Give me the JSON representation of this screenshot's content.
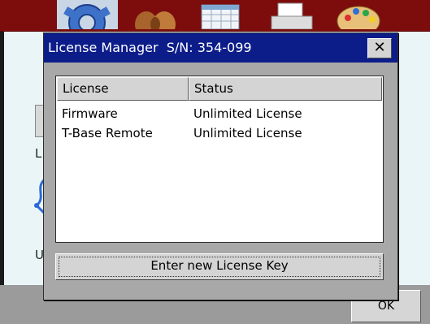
{
  "background": {
    "letters": [
      "L",
      "U"
    ],
    "ok_label": "OK"
  },
  "dialog": {
    "title": "License Manager  S/N: 354-099",
    "close_glyph": "✕",
    "columns": [
      "License",
      "Status"
    ],
    "rows": [
      {
        "license": "Firmware",
        "status": "Unlimited License"
      },
      {
        "license": "T-Base Remote",
        "status": "Unlimited License"
      }
    ],
    "enter_key_label": "Enter new License Key"
  },
  "colors": {
    "titlebar": "#0c1d8a",
    "toolbar": "#7d0c0c",
    "dialog_body": "#a8a8a8"
  },
  "icons": [
    "gear-icon",
    "hands-icon",
    "calendar-icon",
    "printer-icon",
    "palette-icon",
    "document-icon",
    "network-icon"
  ]
}
